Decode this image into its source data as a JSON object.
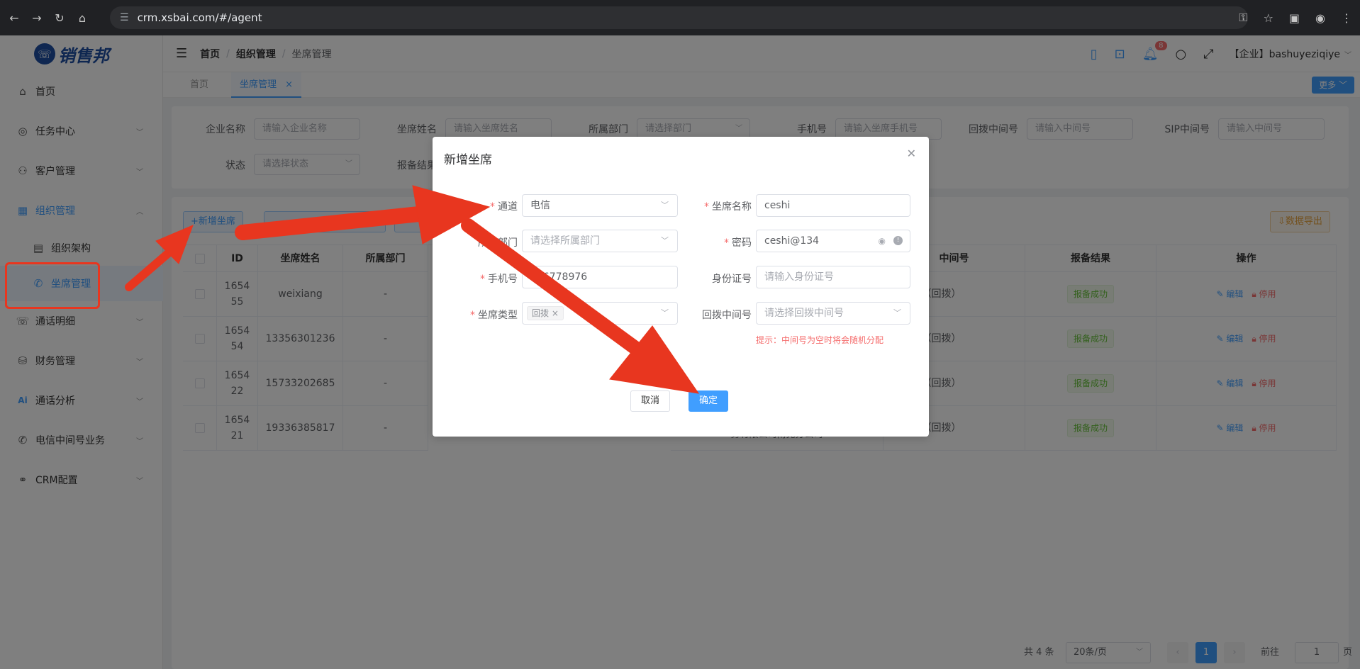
{
  "browser": {
    "url": "crm.xsbai.com/#/agent"
  },
  "logo": {
    "mark": "☏",
    "text": "销售邦"
  },
  "sidebar": {
    "items": [
      {
        "label": "首页"
      },
      {
        "label": "任务中心"
      },
      {
        "label": "客户管理"
      },
      {
        "label": "组织管理"
      },
      {
        "label": "组织架构"
      },
      {
        "label": "坐席管理"
      },
      {
        "label": "通话明细"
      },
      {
        "label": "财务管理"
      },
      {
        "label": "通话分析"
      },
      {
        "label": "电信中间号业务"
      },
      {
        "label": "CRM配置"
      }
    ]
  },
  "header": {
    "crumbs": [
      "首页",
      "组织管理",
      "坐席管理"
    ],
    "sep": "/",
    "notif_count": "8",
    "user": "【企业】bashuyeziqiye"
  },
  "tabs": {
    "home": "首页",
    "agent": "坐席管理",
    "close": "×",
    "more": "更多"
  },
  "filters": {
    "company_label": "企业名称",
    "company_ph": "请输入企业名称",
    "agent_label": "坐席姓名",
    "agent_ph": "请输入坐席姓名",
    "dept_label": "所属部门",
    "dept_ph": "请选择部门",
    "phone_label": "手机号",
    "phone_ph": "请输入坐席手机号",
    "callback_label": "回拨中间号",
    "callback_ph": "请输入中间号",
    "sip_label": "SIP中间号",
    "sip_ph": "请输入中间号",
    "status_label": "状态",
    "status_ph": "请选择状态",
    "report_label": "报备结果"
  },
  "toolbar": {
    "add": "+新增坐席",
    "export": "⇩数据导出"
  },
  "table": {
    "headers": {
      "id": "ID",
      "name": "坐席姓名",
      "dept": "所属部门",
      "middle": "中间号",
      "report": "报备结果",
      "ops": "操作"
    },
    "rows": [
      {
        "id": "1654\n55",
        "name": "weixiang",
        "dept": "-",
        "middle": "385817（回拨）",
        "report": "报备成功"
      },
      {
        "id": "1654\n54",
        "name": "13356301236",
        "dept": "-",
        "middle": "385817（回拨）",
        "report": "报备成功"
      },
      {
        "id": "1654\n22",
        "name": "15733202685",
        "dept": "-",
        "middle": "385817（回拨）",
        "report": "报备成功"
      },
      {
        "id": "1654\n21",
        "name": "19336385817",
        "dept": "-",
        "middle": "385817（回拨）",
        "report": "报备成功"
      }
    ],
    "row4_company": "务有限公司南充分公司",
    "edit": "编辑",
    "stop": "停用"
  },
  "pager": {
    "total": "共 4 条",
    "size": "20条/页",
    "page": "1",
    "goto": "前往",
    "goto_val": "1",
    "unit": "页"
  },
  "dialog": {
    "title": "新增坐席",
    "channel_label": "通道",
    "channel_val": "电信",
    "name_label": "坐席名称",
    "name_val": "ceshi",
    "dept_label": "所属部门",
    "dept_ph": "请选择所属部门",
    "pwd_label": "密码",
    "pwd_val": "ceshi@134",
    "phone_label": "手机号",
    "phone_val": "166778976",
    "idcard_label": "身份证号",
    "idcard_ph": "请输入身份证号",
    "type_label": "坐席类型",
    "type_tag": "回拨",
    "callback_label": "回拨中间号",
    "callback_ph": "请选择回拨中间号",
    "hint": "提示：中间号为空时将会随机分配",
    "cancel": "取消",
    "ok": "确定"
  },
  "colors": {
    "primary": "#409eff",
    "annotation": "#e8361f",
    "success": "#67c23a",
    "danger": "#f56c6c"
  }
}
